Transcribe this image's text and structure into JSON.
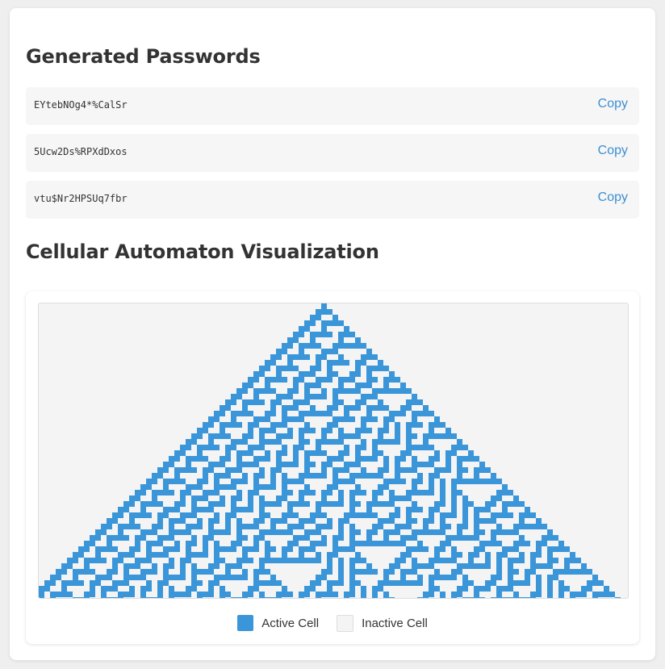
{
  "passwords_section": {
    "title": "Generated Passwords",
    "items": [
      {
        "value": "EYtebNOg4*%CalSr",
        "copy_label": "Copy"
      },
      {
        "value": "5Ucw2Ds%RPXdDxos",
        "copy_label": "Copy"
      },
      {
        "value": "vtu$Nr2HPSUq7fbr",
        "copy_label": "Copy"
      }
    ]
  },
  "automaton_section": {
    "title": "Cellular Automaton Visualization",
    "rule": 30,
    "generations": 53,
    "legend": {
      "active_label": "Active Cell",
      "inactive_label": "Inactive Cell"
    }
  },
  "colors": {
    "accent": "#3d8fd3",
    "active_cell": "#3a96d8",
    "inactive_cell": "#f4f4f4",
    "page_background": "#efefef",
    "card_background": "#ffffff",
    "row_background": "#f6f6f6"
  }
}
